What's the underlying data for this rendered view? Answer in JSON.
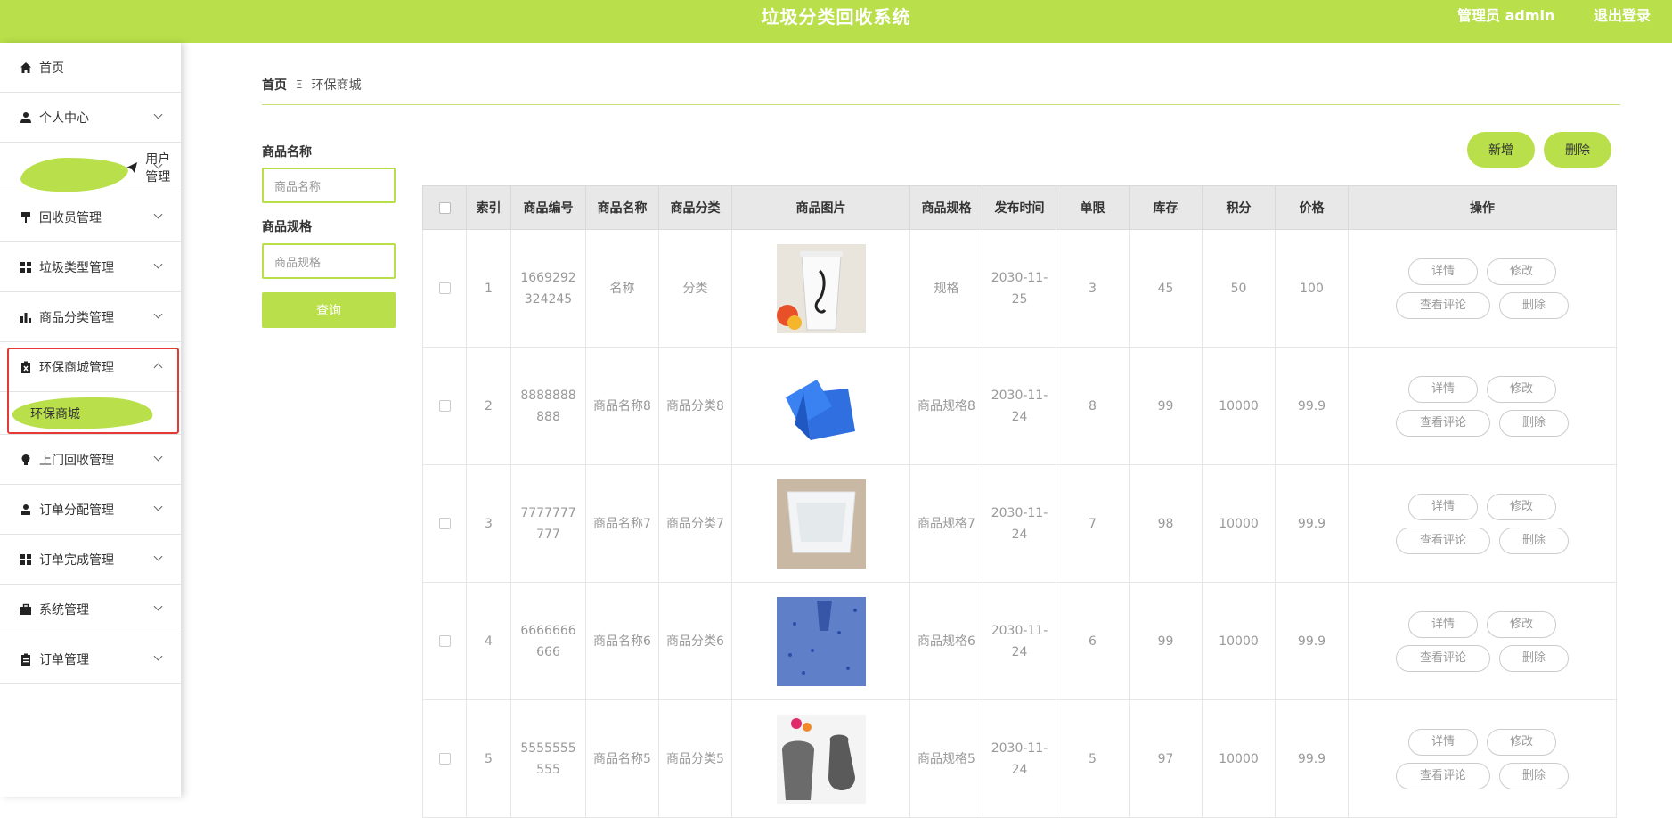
{
  "header": {
    "title": "垃圾分类回收系统",
    "user_label": "管理员 admin",
    "logout_label": "退出登录",
    "accent_color": "#b9e04a"
  },
  "sidebar": {
    "items": [
      {
        "label": "首页",
        "icon": "home-icon",
        "expandable": false
      },
      {
        "label": "个人中心",
        "icon": "user-icon",
        "expandable": true
      },
      {
        "label": "用户管理",
        "icon": "paper-plane-icon",
        "expandable": true,
        "highlighted": true
      },
      {
        "label": "回收员管理",
        "icon": "paint-roller-icon",
        "expandable": true
      },
      {
        "label": "垃圾类型管理",
        "icon": "grid-icon",
        "expandable": true
      },
      {
        "label": "商品分类管理",
        "icon": "bar-chart-icon",
        "expandable": true
      },
      {
        "label": "环保商城管理",
        "icon": "clipboard-x-icon",
        "expandable": true,
        "expanded": true
      },
      {
        "label": "上门回收管理",
        "icon": "lightbulb-icon",
        "expandable": true
      },
      {
        "label": "订单分配管理",
        "icon": "person-icon",
        "expandable": true
      },
      {
        "label": "订单完成管理",
        "icon": "grid-icon",
        "expandable": true
      },
      {
        "label": "系统管理",
        "icon": "briefcase-icon",
        "expandable": true
      },
      {
        "label": "订单管理",
        "icon": "clipboard-icon",
        "expandable": true
      }
    ],
    "submenu": {
      "label": "环保商城",
      "active": true
    }
  },
  "breadcrumb": {
    "home": "首页",
    "separator": "Ξ",
    "current": "环保商城"
  },
  "filters": {
    "name_label": "商品名称",
    "name_placeholder": "商品名称",
    "spec_label": "商品规格",
    "spec_placeholder": "商品规格",
    "query_label": "查询"
  },
  "actions": {
    "add_label": "新增",
    "delete_label": "删除"
  },
  "table": {
    "headers": [
      "索引",
      "商品编号",
      "商品名称",
      "商品分类",
      "商品图片",
      "商品规格",
      "发布时间",
      "单限",
      "库存",
      "积分",
      "价格",
      "操作"
    ],
    "op_labels": {
      "detail": "详情",
      "edit": "修改",
      "comments": "查看评论",
      "delete": "删除"
    },
    "rows": [
      {
        "index": "1",
        "code": "1669292324245",
        "name": "名称",
        "category": "分类",
        "image": "cup-image",
        "spec": "规格",
        "time": "2030-11-25",
        "limit": "3",
        "stock": "45",
        "points": "50",
        "price": "100"
      },
      {
        "index": "2",
        "code": "8888888888",
        "name": "商品名称8",
        "category": "商品分类8",
        "image": "blue-crate-image",
        "spec": "商品规格8",
        "time": "2030-11-24",
        "limit": "8",
        "stock": "99",
        "points": "10000",
        "price": "99.9"
      },
      {
        "index": "3",
        "code": "7777777777",
        "name": "商品名称7",
        "category": "商品分类7",
        "image": "plastic-tray-image",
        "spec": "商品规格7",
        "time": "2030-11-24",
        "limit": "7",
        "stock": "98",
        "points": "10000",
        "price": "99.9"
      },
      {
        "index": "4",
        "code": "6666666666",
        "name": "商品名称6",
        "category": "商品分类6",
        "image": "blue-pellets-image",
        "spec": "商品规格6",
        "time": "2030-11-24",
        "limit": "6",
        "stock": "99",
        "points": "10000",
        "price": "99.9"
      },
      {
        "index": "5",
        "code": "5555555555",
        "name": "商品名称5",
        "category": "商品分类5",
        "image": "vase-image",
        "spec": "商品规格5",
        "time": "2030-11-24",
        "limit": "5",
        "stock": "97",
        "points": "10000",
        "price": "99.9"
      }
    ]
  }
}
